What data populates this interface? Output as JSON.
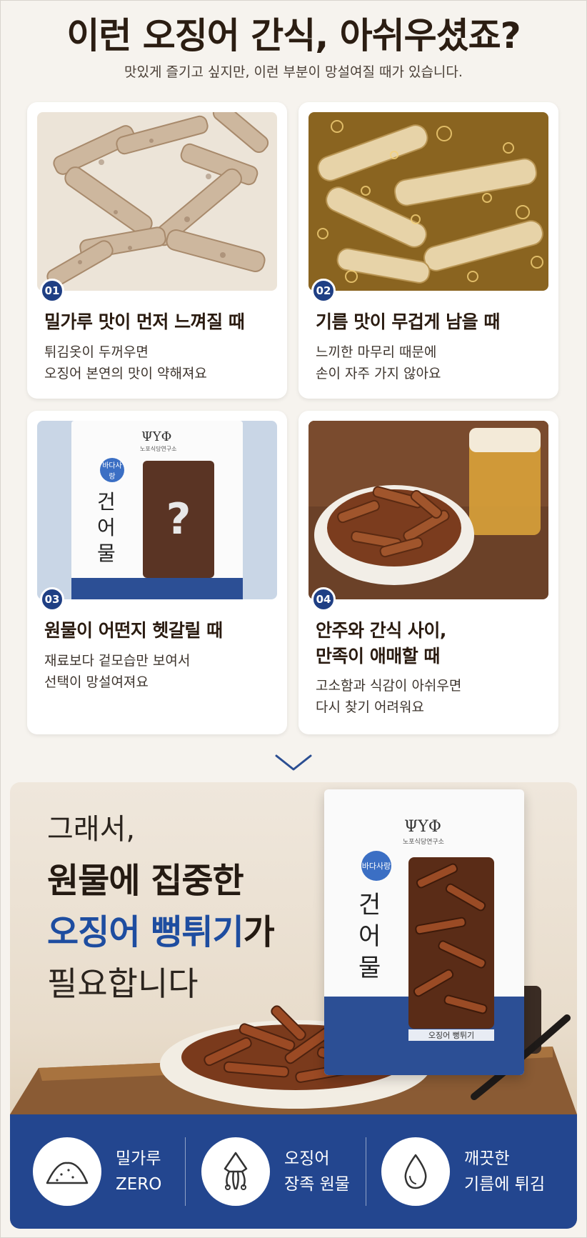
{
  "header": {
    "title": "이런 오징어 간식, 아쉬우셨죠?",
    "subtitle": "맛있게 즐기고 싶지만, 이런 부분이 망설여질 때가 있습니다."
  },
  "cards": [
    {
      "number": "01",
      "title": "밀가루 맛이 먼저 느껴질 때",
      "desc_line1": "튀김옷이 두꺼우면",
      "desc_line2": "오징어 본연의 맛이 약해져요"
    },
    {
      "number": "02",
      "title": "기름 맛이 무겁게 남을 때",
      "desc_line1": "느끼한 마무리 때문에",
      "desc_line2": "손이 자주 가지 않아요"
    },
    {
      "number": "03",
      "title": "원물이 어떤지 헷갈릴 때",
      "desc_line1": "재료보다 겉모습만 보여서",
      "desc_line2": "선택이 망설여져요",
      "package": {
        "brand_side": "바다사랑",
        "brand_main": "건어물",
        "logo": "ΨΥΦ",
        "logo_sub": "노포식당연구소",
        "mystery": "?"
      }
    },
    {
      "number": "04",
      "title_line1": "안주와 간식 사이,",
      "title_line2": "만족이 애매할 때",
      "desc_line1": "고소함과 식감이 아쉬우면",
      "desc_line2": "다시 찾기 어려워요"
    }
  ],
  "hero": {
    "line1": "그래서,",
    "line2": "원물에 집중한",
    "line3_accent": "오징어 뻥튀기",
    "line3_rest": "가",
    "line4": "필요합니다",
    "package": {
      "brand_side": "바다사랑",
      "brand_main": "건어물",
      "logo": "ΨΥΦ",
      "logo_sub": "노포식당연구소",
      "product_label": "오징어 뻥튀기"
    }
  },
  "features": [
    {
      "icon": "flour-icon",
      "line1": "밀가루",
      "line2": "ZERO"
    },
    {
      "icon": "squid-icon",
      "line1": "오징어",
      "line2": "장족 원물"
    },
    {
      "icon": "oil-drop-icon",
      "line1": "깨끗한",
      "line2": "기름에 튀김"
    }
  ],
  "colors": {
    "accent": "#1e4da0",
    "badge": "#1f3f84",
    "feature_bar": "#23468f",
    "title": "#2b1d12"
  }
}
